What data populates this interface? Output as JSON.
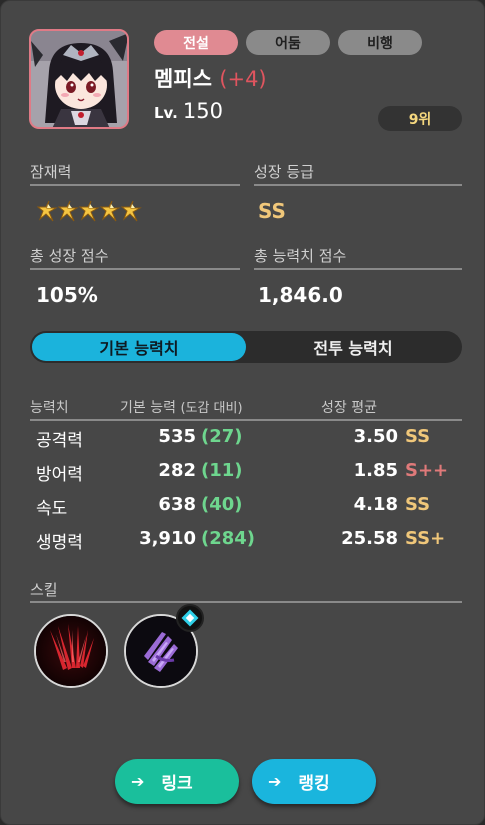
{
  "character": {
    "tags": [
      "전설",
      "어둠",
      "비행"
    ],
    "name": "멤피스",
    "enhance": "(+4)",
    "level_prefix": "Lv.",
    "level": "150",
    "rank": "9위"
  },
  "summary": {
    "potential_label": "잠재력",
    "potential_stars": 5,
    "growth_grade_label": "성장 등급",
    "growth_grade": "SS",
    "total_growth_label": "총 성장 점수",
    "total_growth": "105%",
    "total_stat_label": "총 능력치 점수",
    "total_stat": "1,846.0"
  },
  "tabs": {
    "basic": "기본 능력치",
    "battle": "전투 능력치"
  },
  "stats": {
    "header_stat": "능력치",
    "header_base": "기본 능력",
    "header_base_note": "(도감 대비)",
    "header_avg": "성장 평균",
    "rows": [
      {
        "name": "공격력",
        "base": "535",
        "bonus": "(27)",
        "avg": "3.50",
        "grade": "SS"
      },
      {
        "name": "방어력",
        "base": "282",
        "bonus": "(11)",
        "avg": "1.85",
        "grade": "S++"
      },
      {
        "name": "속도",
        "base": "638",
        "bonus": "(40)",
        "avg": "4.18",
        "grade": "SS"
      },
      {
        "name": "생명력",
        "base": "3,910",
        "bonus": "(284)",
        "avg": "25.58",
        "grade": "SS+"
      }
    ]
  },
  "skills": {
    "label": "스킬",
    "items": [
      "claw-slash-icon",
      "shadow-claw-icon"
    ]
  },
  "buttons": {
    "link": "링크",
    "ranking": "랭킹"
  },
  "colors": {
    "legend_tag": "#e08a92",
    "grade_ss": "#f0c77a",
    "grade_spp": "#e07a7a",
    "bonus_green": "#6ed68e",
    "accent_cyan": "#1bb3dc",
    "link_green": "#1abf9c"
  }
}
